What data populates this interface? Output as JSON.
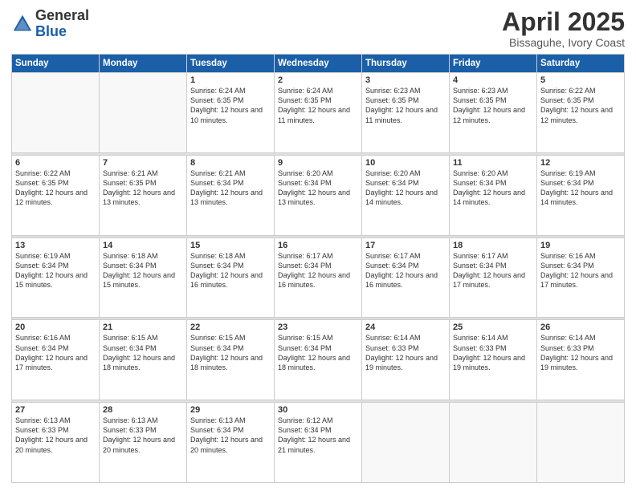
{
  "logo": {
    "general": "General",
    "blue": "Blue"
  },
  "header": {
    "title": "April 2025",
    "subtitle": "Bissaguhe, Ivory Coast"
  },
  "weekdays": [
    "Sunday",
    "Monday",
    "Tuesday",
    "Wednesday",
    "Thursday",
    "Friday",
    "Saturday"
  ],
  "weeks": [
    [
      {
        "day": "",
        "info": ""
      },
      {
        "day": "",
        "info": ""
      },
      {
        "day": "1",
        "info": "Sunrise: 6:24 AM\nSunset: 6:35 PM\nDaylight: 12 hours and 10 minutes."
      },
      {
        "day": "2",
        "info": "Sunrise: 6:24 AM\nSunset: 6:35 PM\nDaylight: 12 hours and 11 minutes."
      },
      {
        "day": "3",
        "info": "Sunrise: 6:23 AM\nSunset: 6:35 PM\nDaylight: 12 hours and 11 minutes."
      },
      {
        "day": "4",
        "info": "Sunrise: 6:23 AM\nSunset: 6:35 PM\nDaylight: 12 hours and 12 minutes."
      },
      {
        "day": "5",
        "info": "Sunrise: 6:22 AM\nSunset: 6:35 PM\nDaylight: 12 hours and 12 minutes."
      }
    ],
    [
      {
        "day": "6",
        "info": "Sunrise: 6:22 AM\nSunset: 6:35 PM\nDaylight: 12 hours and 12 minutes."
      },
      {
        "day": "7",
        "info": "Sunrise: 6:21 AM\nSunset: 6:35 PM\nDaylight: 12 hours and 13 minutes."
      },
      {
        "day": "8",
        "info": "Sunrise: 6:21 AM\nSunset: 6:34 PM\nDaylight: 12 hours and 13 minutes."
      },
      {
        "day": "9",
        "info": "Sunrise: 6:20 AM\nSunset: 6:34 PM\nDaylight: 12 hours and 13 minutes."
      },
      {
        "day": "10",
        "info": "Sunrise: 6:20 AM\nSunset: 6:34 PM\nDaylight: 12 hours and 14 minutes."
      },
      {
        "day": "11",
        "info": "Sunrise: 6:20 AM\nSunset: 6:34 PM\nDaylight: 12 hours and 14 minutes."
      },
      {
        "day": "12",
        "info": "Sunrise: 6:19 AM\nSunset: 6:34 PM\nDaylight: 12 hours and 14 minutes."
      }
    ],
    [
      {
        "day": "13",
        "info": "Sunrise: 6:19 AM\nSunset: 6:34 PM\nDaylight: 12 hours and 15 minutes."
      },
      {
        "day": "14",
        "info": "Sunrise: 6:18 AM\nSunset: 6:34 PM\nDaylight: 12 hours and 15 minutes."
      },
      {
        "day": "15",
        "info": "Sunrise: 6:18 AM\nSunset: 6:34 PM\nDaylight: 12 hours and 16 minutes."
      },
      {
        "day": "16",
        "info": "Sunrise: 6:17 AM\nSunset: 6:34 PM\nDaylight: 12 hours and 16 minutes."
      },
      {
        "day": "17",
        "info": "Sunrise: 6:17 AM\nSunset: 6:34 PM\nDaylight: 12 hours and 16 minutes."
      },
      {
        "day": "18",
        "info": "Sunrise: 6:17 AM\nSunset: 6:34 PM\nDaylight: 12 hours and 17 minutes."
      },
      {
        "day": "19",
        "info": "Sunrise: 6:16 AM\nSunset: 6:34 PM\nDaylight: 12 hours and 17 minutes."
      }
    ],
    [
      {
        "day": "20",
        "info": "Sunrise: 6:16 AM\nSunset: 6:34 PM\nDaylight: 12 hours and 17 minutes."
      },
      {
        "day": "21",
        "info": "Sunrise: 6:15 AM\nSunset: 6:34 PM\nDaylight: 12 hours and 18 minutes."
      },
      {
        "day": "22",
        "info": "Sunrise: 6:15 AM\nSunset: 6:34 PM\nDaylight: 12 hours and 18 minutes."
      },
      {
        "day": "23",
        "info": "Sunrise: 6:15 AM\nSunset: 6:34 PM\nDaylight: 12 hours and 18 minutes."
      },
      {
        "day": "24",
        "info": "Sunrise: 6:14 AM\nSunset: 6:33 PM\nDaylight: 12 hours and 19 minutes."
      },
      {
        "day": "25",
        "info": "Sunrise: 6:14 AM\nSunset: 6:33 PM\nDaylight: 12 hours and 19 minutes."
      },
      {
        "day": "26",
        "info": "Sunrise: 6:14 AM\nSunset: 6:33 PM\nDaylight: 12 hours and 19 minutes."
      }
    ],
    [
      {
        "day": "27",
        "info": "Sunrise: 6:13 AM\nSunset: 6:33 PM\nDaylight: 12 hours and 20 minutes."
      },
      {
        "day": "28",
        "info": "Sunrise: 6:13 AM\nSunset: 6:33 PM\nDaylight: 12 hours and 20 minutes."
      },
      {
        "day": "29",
        "info": "Sunrise: 6:13 AM\nSunset: 6:34 PM\nDaylight: 12 hours and 20 minutes."
      },
      {
        "day": "30",
        "info": "Sunrise: 6:12 AM\nSunset: 6:34 PM\nDaylight: 12 hours and 21 minutes."
      },
      {
        "day": "",
        "info": ""
      },
      {
        "day": "",
        "info": ""
      },
      {
        "day": "",
        "info": ""
      }
    ]
  ]
}
